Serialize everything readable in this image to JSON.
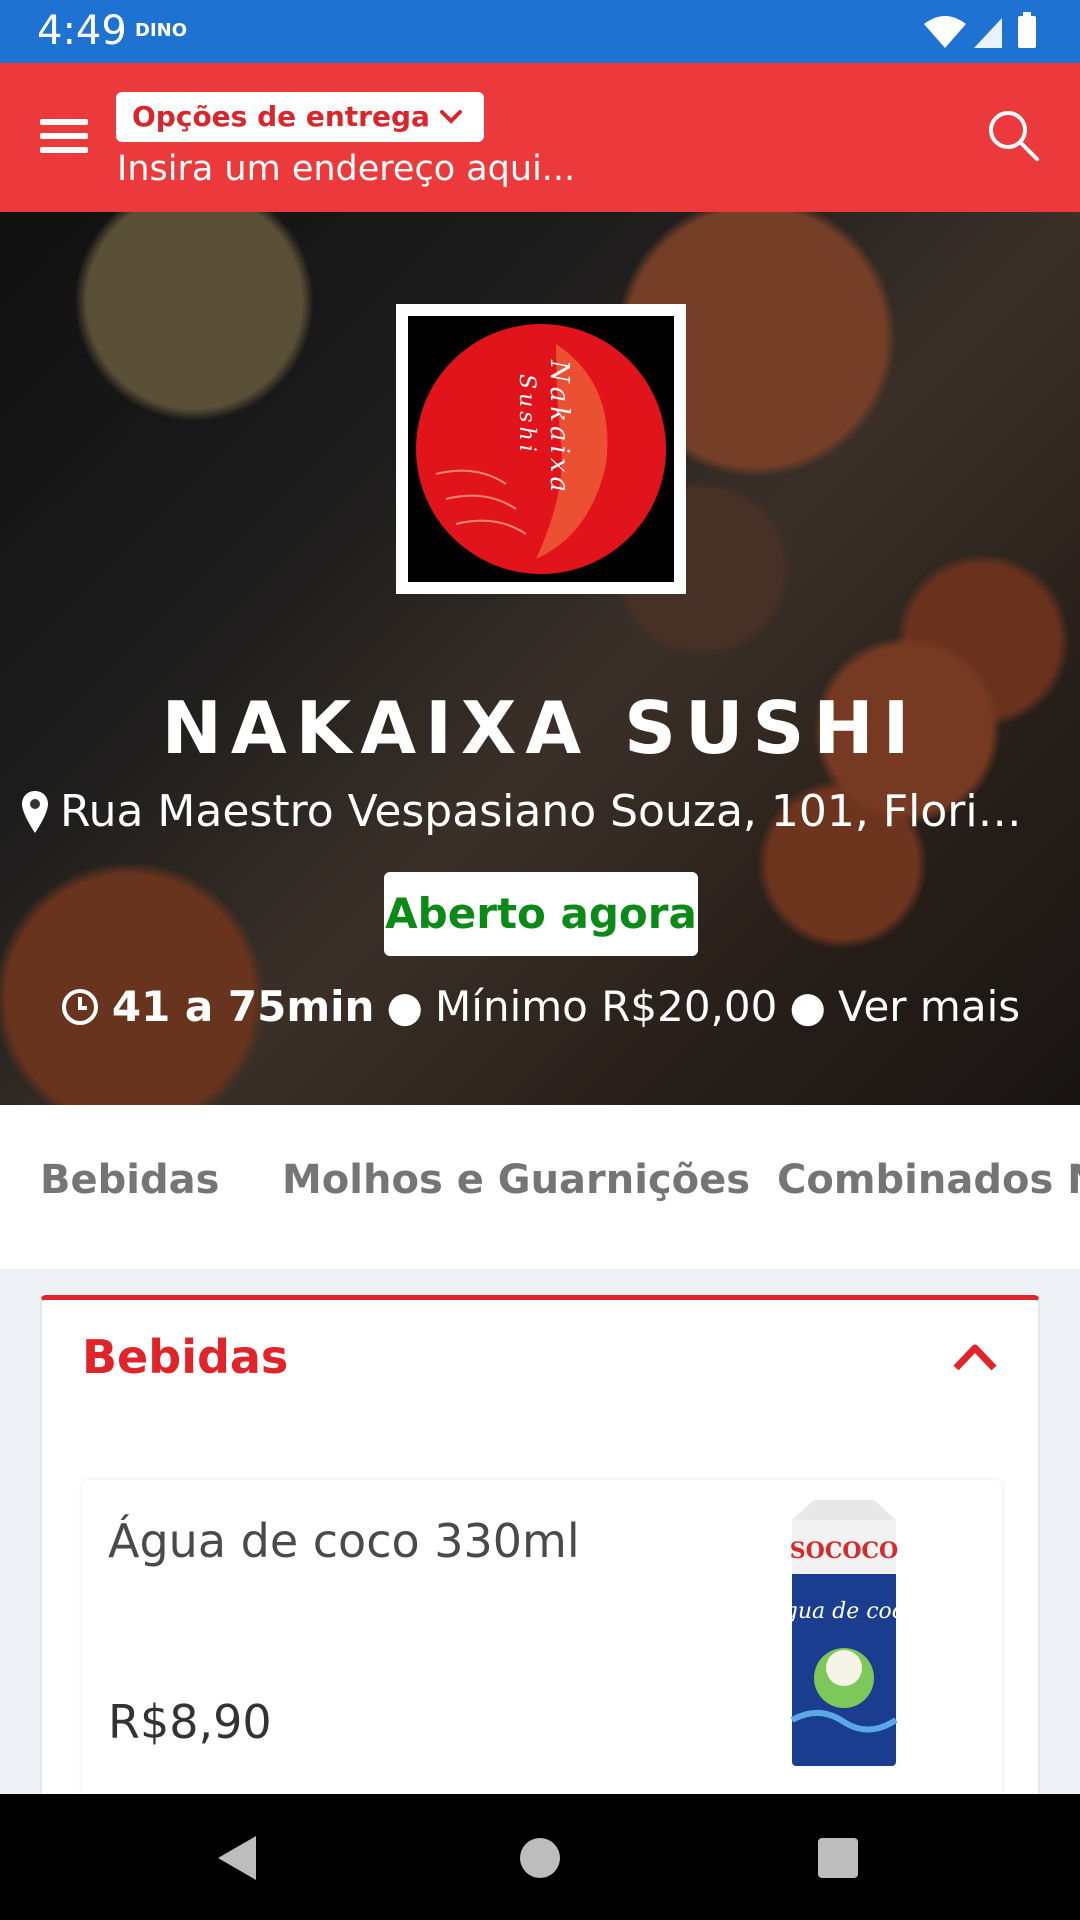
{
  "status_bar": {
    "time": "4:49",
    "app_badge": "DINO"
  },
  "header": {
    "delivery_options_label": "Opções de entrega",
    "address_placeholder": "Insira um endereço aqui..."
  },
  "restaurant": {
    "name": "NAKAIXA SUSHI",
    "logo_text_1": "Nakaixa",
    "logo_text_2": "Sushi",
    "address": "Rua Maestro Vespasiano Souza, 101, Flori…",
    "status": "Aberto agora",
    "delivery_time": "41 a 75min",
    "minimum": "Mínimo R$20,00",
    "more_link": "Ver mais",
    "separator": "●"
  },
  "tabs": [
    "Bebidas",
    "Molhos e Guarnições",
    "Combinados Na"
  ],
  "section": {
    "title": "Bebidas",
    "products": [
      {
        "name": "Água de coco 330ml",
        "price": "R$8,90",
        "image_brand": "SOCOCO",
        "image_text": "água de coco"
      }
    ]
  },
  "colors": {
    "status_bar": "#1e73d2",
    "header": "#ec3a3c",
    "accent_red": "#e0242a",
    "open_green": "#0b8a17"
  },
  "icons": {
    "menu": "menu-icon",
    "search": "search-icon",
    "location": "location-pin-icon",
    "clock": "clock-icon",
    "collapse": "chevron-up-icon",
    "nav_back": "back-triangle-icon",
    "nav_home": "home-circle-icon",
    "nav_recents": "recents-square-icon"
  }
}
